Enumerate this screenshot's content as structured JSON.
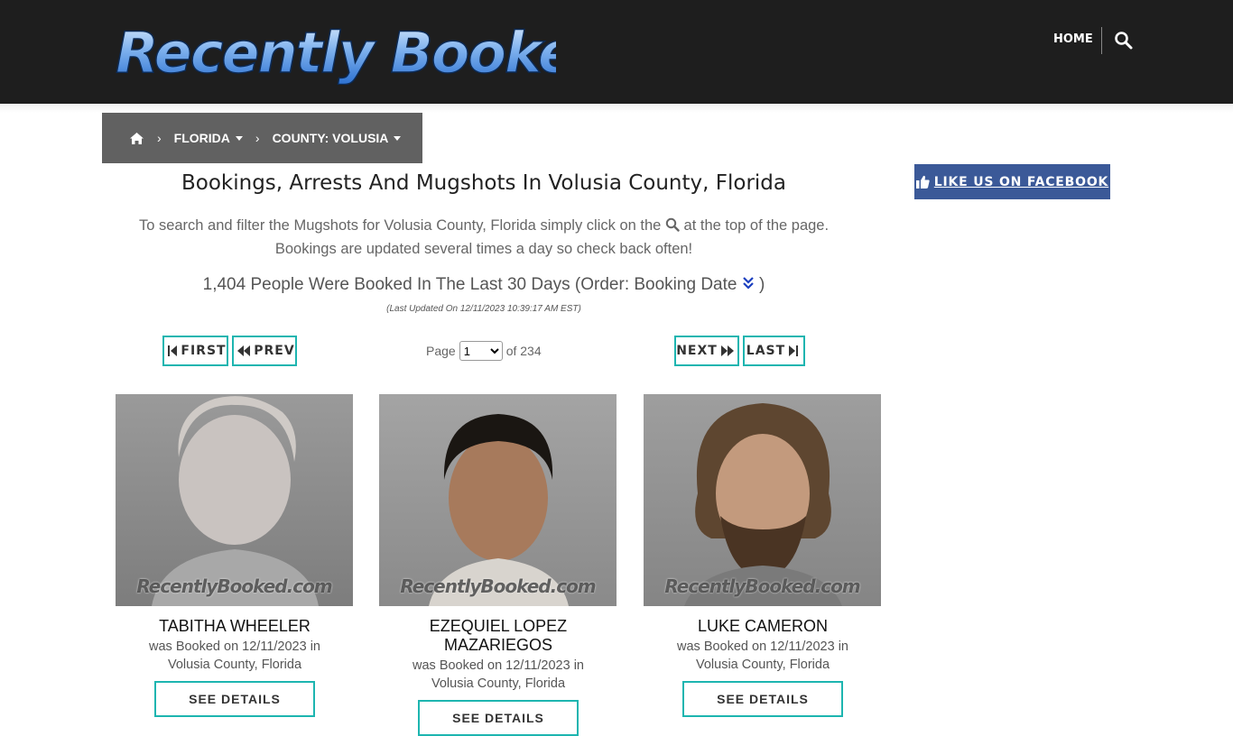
{
  "site": {
    "logo_text": "Recently Booked",
    "nav_home": "HOME",
    "search_icon": "search-icon"
  },
  "breadcrumb": {
    "home_icon": "home-icon",
    "items": [
      {
        "label": "FLORIDA"
      },
      {
        "label": "COUNTY: VOLUSIA"
      }
    ]
  },
  "main": {
    "title": "Bookings, Arrests And Mugshots In Volusia County, Florida",
    "intro_before": "To search and filter the Mugshots for Volusia County, Florida simply click on the",
    "intro_after": "at the top of the page.",
    "intro_line2": "Bookings are updated several times a day so check back often!",
    "count_text": "1,404 People Were Booked In The Last 30 Days (Order: Booking Date",
    "count_close": ")",
    "updated": "(Last Updated On 12/11/2023 10:39:17 AM EST)"
  },
  "pagination": {
    "first": "FIRST",
    "prev": "PREV",
    "next": "NEXT",
    "last": "LAST",
    "page_label": "Page",
    "page_value": "1",
    "of_label": "of 234"
  },
  "cards": [
    {
      "name": "TABITHA WHEELER",
      "line1": "was Booked on 12/11/2023 in",
      "line2": "Volusia County, Florida",
      "button": "SEE DETAILS",
      "watermark": "RecentlyBooked.com"
    },
    {
      "name": "EZEQUIEL LOPEZ MAZARIEGOS",
      "line1": "was Booked on 12/11/2023 in",
      "line2": "Volusia County, Florida",
      "button": "SEE DETAILS",
      "watermark": "RecentlyBooked.com"
    },
    {
      "name": "LUKE CAMERON",
      "line1": "was Booked on 12/11/2023 in",
      "line2": "Volusia County, Florida",
      "button": "SEE DETAILS",
      "watermark": "RecentlyBooked.com"
    }
  ],
  "sidebar": {
    "facebook_label": "LIKE US ON FACEBOOK"
  },
  "colors": {
    "header_bg": "#1e1e1e",
    "breadcrumb_bg": "#616161",
    "accent_teal": "#1db5b0",
    "facebook_blue": "#3b5998"
  }
}
